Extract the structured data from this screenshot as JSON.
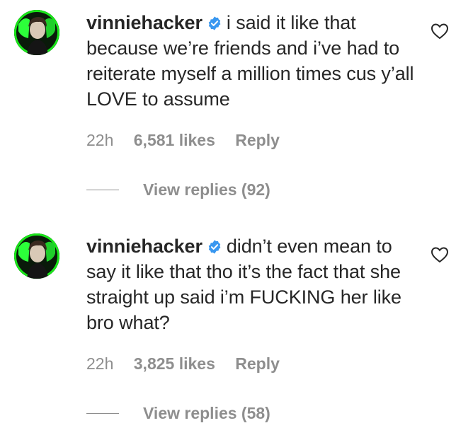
{
  "comments": [
    {
      "username": "vinniehacker",
      "text": "i said it like that because we’re friends and i’ve had to reiterate myself a million times cus y’all LOVE to assume",
      "time": "22h",
      "likes": "6,581 likes",
      "reply_label": "Reply",
      "view_replies": "View replies (92)"
    },
    {
      "username": "vinniehacker",
      "text": "didn’t even mean to say it like that tho it’s the fact that she straight up said i’m FUCKING her like bro what?",
      "time": "22h",
      "likes": "3,825 likes",
      "reply_label": "Reply",
      "view_replies": "View replies (58)"
    }
  ],
  "colors": {
    "text": "#262626",
    "secondary": "#8e8e8e",
    "verified": "#3897f0",
    "avatar_ring": "#19e619"
  },
  "icons": {
    "verified": "verified-badge-icon",
    "like": "heart-outline-icon"
  }
}
